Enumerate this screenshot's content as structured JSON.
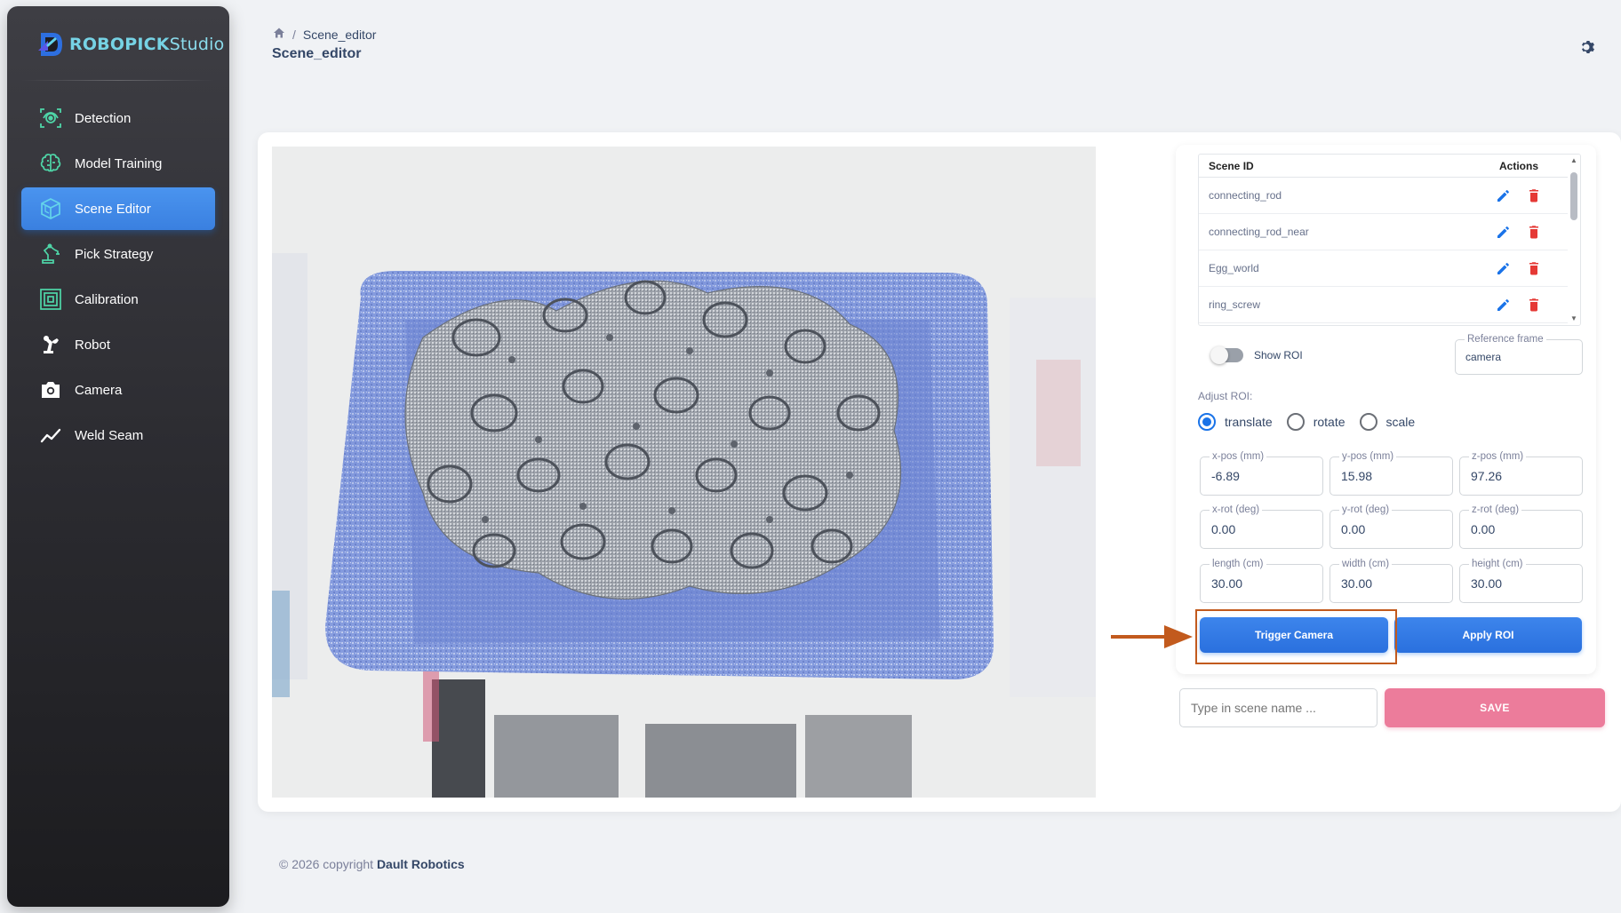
{
  "brand": {
    "name_bold": "ROBOPICK",
    "name_light": "Studio"
  },
  "sidebar": {
    "items": [
      {
        "label": "Detection",
        "icon": "detection-icon",
        "active": false
      },
      {
        "label": "Model Training",
        "icon": "brain-icon",
        "active": false
      },
      {
        "label": "Scene Editor",
        "icon": "cube-icon",
        "active": true
      },
      {
        "label": "Pick Strategy",
        "icon": "robot-arm-icon",
        "active": false
      },
      {
        "label": "Calibration",
        "icon": "calibration-icon",
        "active": false
      },
      {
        "label": "Robot",
        "icon": "robot-icon",
        "active": false
      },
      {
        "label": "Camera",
        "icon": "camera-icon",
        "active": false
      },
      {
        "label": "Weld Seam",
        "icon": "line-chart-icon",
        "active": false
      }
    ]
  },
  "header": {
    "breadcrumb": {
      "current": "Scene_editor"
    },
    "title": "Scene_editor"
  },
  "scenes_table": {
    "columns": [
      "Scene ID",
      "Actions"
    ],
    "rows": [
      "connecting_rod",
      "connecting_rod_near",
      "Egg_world",
      "ring_screw"
    ]
  },
  "roi": {
    "show_roi_label": "Show ROI",
    "show_roi_on": false,
    "reference_frame": {
      "label": "Reference frame",
      "value": "camera"
    },
    "adjust_label": "Adjust ROI:",
    "modes": [
      "translate",
      "rotate",
      "scale"
    ],
    "selected_mode": "translate",
    "fields": [
      {
        "label": "x-pos (mm)",
        "value": "-6.89"
      },
      {
        "label": "y-pos (mm)",
        "value": "15.98"
      },
      {
        "label": "z-pos (mm)",
        "value": "97.26"
      },
      {
        "label": "x-rot (deg)",
        "value": "0.00"
      },
      {
        "label": "y-rot (deg)",
        "value": "0.00"
      },
      {
        "label": "z-rot (deg)",
        "value": "0.00"
      },
      {
        "label": "length (cm)",
        "value": "30.00"
      },
      {
        "label": "width (cm)",
        "value": "30.00"
      },
      {
        "label": "height (cm)",
        "value": "30.00"
      }
    ],
    "trigger_camera_label": "Trigger Camera",
    "apply_roi_label": "Apply ROI"
  },
  "save": {
    "placeholder": "Type in scene name ...",
    "button_label": "SAVE"
  },
  "footer": {
    "prefix": "© 2026 copyright",
    "company": "Dault Robotics"
  },
  "colors": {
    "primary": "#1a73e8",
    "save_pink": "#ec7c9b",
    "delete_red": "#e53935",
    "highlight": "#c25a1d"
  }
}
